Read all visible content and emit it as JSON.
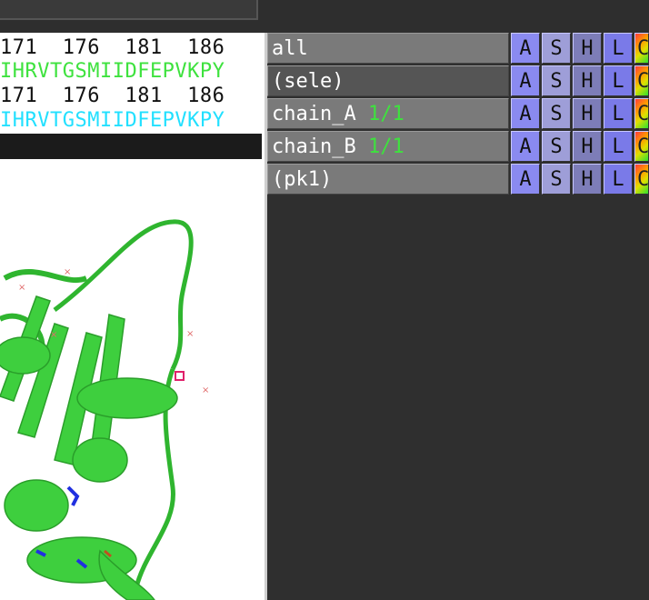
{
  "sequence": {
    "numbers": "171  176  181  186",
    "chain_a_seq": "IHRVTGSMIIDFEPVKPY",
    "numbers2": "171  176  181  186",
    "chain_b_seq": "IHRVTGSMIIDFEPVKPY"
  },
  "objects": [
    {
      "name": "all",
      "count": ""
    },
    {
      "name": "(sele)",
      "count": ""
    },
    {
      "name": "chain_A",
      "count": "1/1"
    },
    {
      "name": "chain_B",
      "count": "1/1"
    },
    {
      "name": "(pk1)",
      "count": ""
    }
  ],
  "buttons": {
    "a": "A",
    "s": "S",
    "h": "H",
    "l": "L",
    "c": "C"
  },
  "colors": {
    "protein": "#3ecf3e",
    "sequence_a": "#3ee23e",
    "sequence_b": "#22e0ff",
    "pick_marker": "#e0206a"
  }
}
